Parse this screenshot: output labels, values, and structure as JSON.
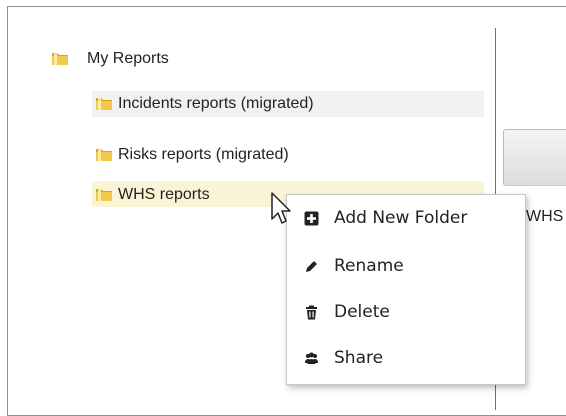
{
  "tree": {
    "root": {
      "label": "My Reports",
      "icon": "folder-icon"
    },
    "children": [
      {
        "label": "Incidents reports (migrated)",
        "icon": "folder-icon",
        "state": "hover"
      },
      {
        "label": "Risks reports (migrated)",
        "icon": "folder-icon",
        "state": "normal"
      },
      {
        "label": "WHS reports",
        "icon": "folder-icon",
        "state": "selected"
      }
    ]
  },
  "right_panel": {
    "text": "WHS"
  },
  "context_menu": {
    "items": [
      {
        "label": "Add New Folder",
        "icon": "add-square-icon"
      },
      {
        "label": "Rename",
        "icon": "pencil-icon"
      },
      {
        "label": "Delete",
        "icon": "trash-icon"
      },
      {
        "label": "Share",
        "icon": "users-icon"
      }
    ]
  },
  "colors": {
    "hover_row": "#f1f1f1",
    "selected_row": "#fbf3d5",
    "folder": "#e8b83a"
  }
}
